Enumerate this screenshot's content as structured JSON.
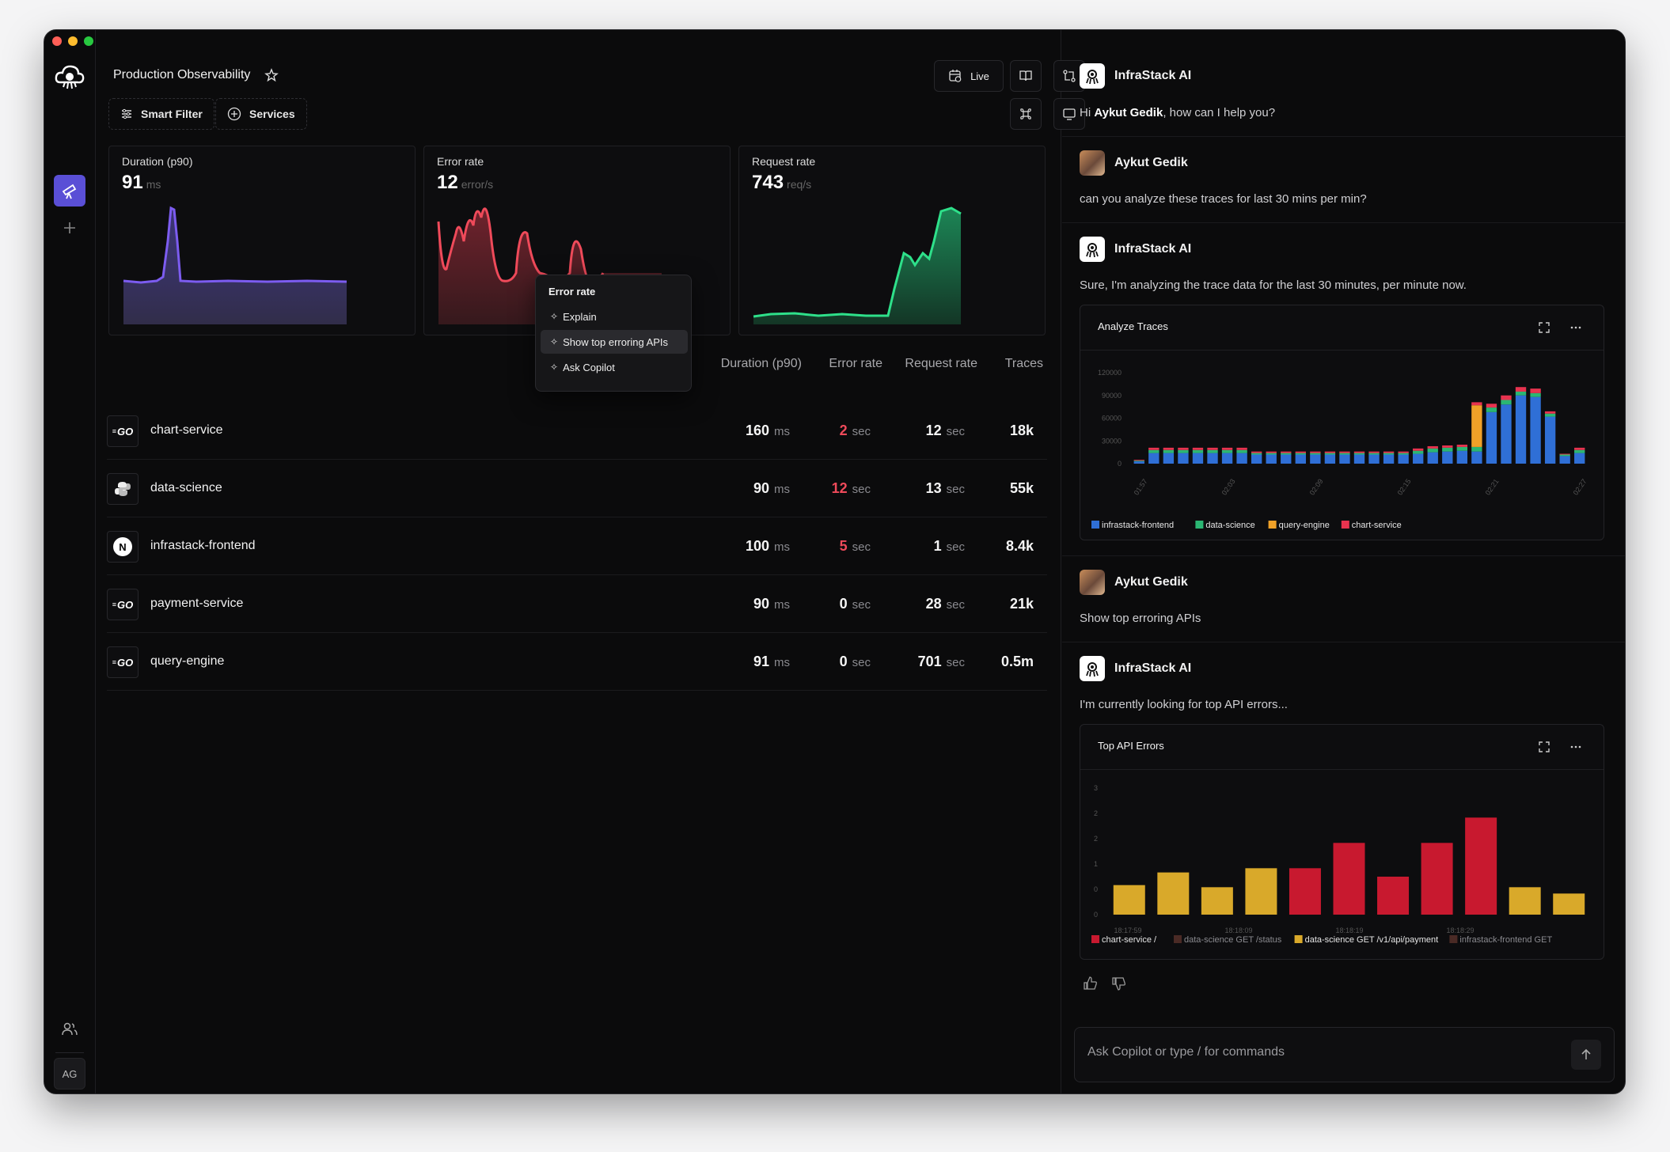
{
  "window": {
    "traffic_colors": [
      "#ff5f57",
      "#febc2e",
      "#28c840"
    ]
  },
  "sidebar": {
    "user_initials": "AG"
  },
  "header": {
    "title": "Production Observability",
    "live_label": "Live",
    "smart_filter_label": "Smart Filter",
    "services_label": "Services"
  },
  "cards": [
    {
      "label": "Duration (p90)",
      "value": "91",
      "unit": "ms",
      "color": "#7c5cf0"
    },
    {
      "label": "Error rate",
      "value": "12",
      "unit": "error/s",
      "color": "#ef4a5a"
    },
    {
      "label": "Request rate",
      "value": "743",
      "unit": "req/s",
      "color": "#2ee08a"
    }
  ],
  "context_menu": {
    "title": "Error rate",
    "items": [
      "Explain",
      "Show top erroring APIs",
      "Ask Copilot"
    ]
  },
  "table": {
    "headers": [
      "Duration (p90)",
      "Error rate",
      "Request rate",
      "Traces"
    ],
    "rows": [
      {
        "icon": "go-icon",
        "icon_text": "GO",
        "name": "chart-service",
        "duration": "160",
        "duration_unit": "ms",
        "error": "2",
        "error_unit": "sec",
        "error_red": true,
        "request": "12",
        "request_unit": "sec",
        "traces": "18k"
      },
      {
        "icon": "python-icon",
        "icon_text": "",
        "name": "data-science",
        "duration": "90",
        "duration_unit": "ms",
        "error": "12",
        "error_unit": "sec",
        "error_red": true,
        "request": "13",
        "request_unit": "sec",
        "traces": "55k"
      },
      {
        "icon": "nextjs-icon",
        "icon_text": "N",
        "name": "infrastack-frontend",
        "duration": "100",
        "duration_unit": "ms",
        "error": "5",
        "error_unit": "sec",
        "error_red": true,
        "request": "1",
        "request_unit": "sec",
        "traces": "8.4k"
      },
      {
        "icon": "go-icon",
        "icon_text": "GO",
        "name": "payment-service",
        "duration": "90",
        "duration_unit": "ms",
        "error": "0",
        "error_unit": "sec",
        "error_red": false,
        "request": "28",
        "request_unit": "sec",
        "traces": "21k"
      },
      {
        "icon": "go-icon",
        "icon_text": "GO",
        "name": "query-engine",
        "duration": "91",
        "duration_unit": "ms",
        "error": "0",
        "error_unit": "sec",
        "error_red": false,
        "request": "701",
        "request_unit": "sec",
        "traces": "0.5m"
      }
    ]
  },
  "chat": {
    "ai_name": "InfraStack AI",
    "user_name": "Aykut Gedik",
    "greeting_prefix": "Hi ",
    "greeting_suffix": ", how can I help you?",
    "msg_user_1": "can you analyze these traces for last 30 mins per min?",
    "msg_ai_2": "Sure, I'm analyzing the trace data for the last 30 minutes, per minute now.",
    "msg_user_2": "Show top erroring APIs",
    "msg_ai_3": "I'm currently looking for top API errors...",
    "input_placeholder": "Ask Copilot or type / for commands"
  },
  "chart_data": [
    {
      "type": "bar",
      "stacked": true,
      "title": "Analyze Traces",
      "yticks": [
        "120000",
        "90000",
        "60000",
        "30000",
        "0"
      ],
      "ylim": [
        0,
        120000
      ],
      "xticks": [
        "01:57",
        "02:03",
        "02:09",
        "02:15",
        "02:21",
        "02:27"
      ],
      "legend_position": "bottom-left",
      "series": [
        {
          "name": "infrastack-frontend",
          "color": "#2f6fd6",
          "values": [
            3000,
            14000,
            14000,
            14000,
            14000,
            14000,
            14000,
            14000,
            12000,
            12000,
            12000,
            12000,
            12000,
            12000,
            12000,
            12000,
            12000,
            12000,
            12000,
            13000,
            15000,
            16000,
            17000,
            16000,
            68000,
            78000,
            90000,
            88000,
            62000,
            10000,
            14000
          ]
        },
        {
          "name": "data-science",
          "color": "#2bb673",
          "values": [
            1000,
            4000,
            4000,
            4000,
            4000,
            4000,
            4000,
            4000,
            2000,
            2000,
            2000,
            2000,
            2000,
            2000,
            2000,
            2000,
            2000,
            2000,
            2000,
            4000,
            5000,
            5000,
            5000,
            6000,
            6000,
            6000,
            5000,
            5000,
            4000,
            2000,
            4000
          ]
        },
        {
          "name": "query-engine",
          "color": "#f0a128",
          "values": [
            0,
            0,
            0,
            0,
            0,
            0,
            0,
            0,
            0,
            0,
            0,
            0,
            0,
            0,
            0,
            0,
            0,
            0,
            0,
            0,
            0,
            0,
            0,
            55000,
            0,
            0,
            0,
            0,
            0,
            0,
            0
          ]
        },
        {
          "name": "chart-service",
          "color": "#e8334f",
          "values": [
            1000,
            3000,
            3000,
            3000,
            3000,
            3000,
            3000,
            3000,
            2000,
            2000,
            2000,
            2000,
            2000,
            2000,
            2000,
            2000,
            2000,
            2000,
            2000,
            3000,
            3000,
            3000,
            3000,
            4000,
            5000,
            6000,
            6000,
            6000,
            3000,
            1000,
            3000
          ]
        }
      ]
    },
    {
      "type": "bar",
      "title": "Top API Errors",
      "yticks": [
        "3",
        "2",
        "2",
        "1",
        "0",
        "0"
      ],
      "ylim": [
        0,
        3
      ],
      "xticks": [
        "18:17:59",
        "18:18:09",
        "18:18:19",
        "18:18:29"
      ],
      "values": [
        0.7,
        1.0,
        0.65,
        1.1,
        1.1,
        1.7,
        0.9,
        1.7,
        2.3,
        0.65,
        0.5
      ],
      "bar_series": [
        2,
        2,
        2,
        2,
        0,
        0,
        0,
        0,
        0,
        2,
        2
      ],
      "legend_position": "bottom-left",
      "series": [
        {
          "name": "chart-service /",
          "color": "#c8192f"
        },
        {
          "name": "data-science GET /status",
          "color": "#4a2a25"
        },
        {
          "name": "data-science GET /v1/api/payment",
          "color": "#d9a92a"
        },
        {
          "name": "infrastack-frontend GET",
          "color": "#4a2a25"
        }
      ]
    }
  ]
}
